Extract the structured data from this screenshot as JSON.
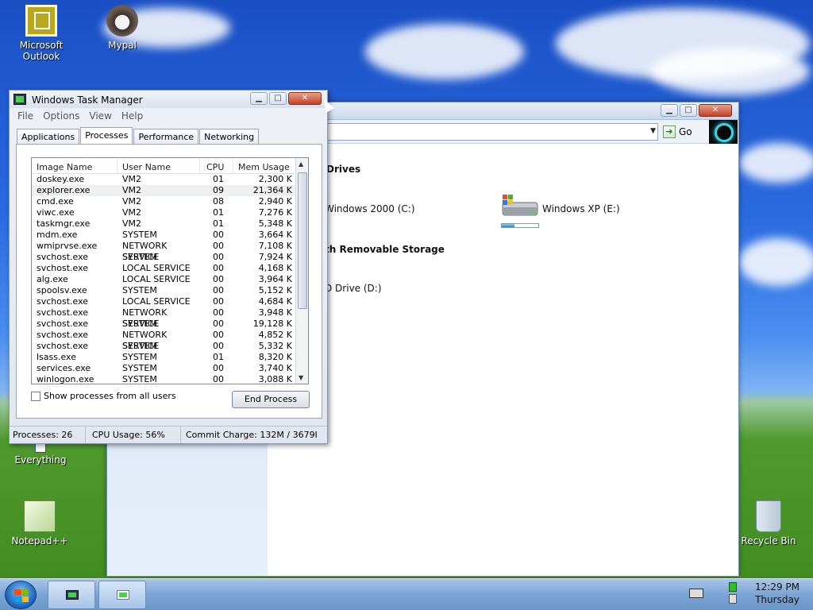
{
  "desktop": {
    "icons": [
      {
        "label": "Microsoft Outlook"
      },
      {
        "label": "Mypal"
      },
      {
        "label": "Everything"
      },
      {
        "label": "Notepad++"
      },
      {
        "label": "Recycle Bin"
      }
    ]
  },
  "explorer": {
    "go_label": "Go",
    "section_drives": "Drives",
    "section_removable": "th Removable Storage",
    "drive_c": "Windows 2000 (C:)",
    "drive_e": "Windows XP (E:)",
    "drive_d": "D Drive (D:)",
    "drive_e_usage_fraction": 0.35
  },
  "task_manager": {
    "title": "Windows Task Manager",
    "menu": [
      "File",
      "Options",
      "View",
      "Help"
    ],
    "tabs": [
      "Applications",
      "Processes",
      "Performance",
      "Networking"
    ],
    "active_tab": "Processes",
    "columns": [
      "Image Name",
      "User Name",
      "CPU",
      "Mem Usage"
    ],
    "processes": [
      [
        "doskey.exe",
        "VM2",
        "01",
        "2,300 K"
      ],
      [
        "explorer.exe",
        "VM2",
        "09",
        "21,364 K"
      ],
      [
        "cmd.exe",
        "VM2",
        "08",
        "2,940 K"
      ],
      [
        "viwc.exe",
        "VM2",
        "01",
        "7,276 K"
      ],
      [
        "taskmgr.exe",
        "VM2",
        "01",
        "5,348 K"
      ],
      [
        "mdm.exe",
        "SYSTEM",
        "00",
        "3,664 K"
      ],
      [
        "wmiprvse.exe",
        "NETWORK SERVICE",
        "00",
        "7,108 K"
      ],
      [
        "svchost.exe",
        "SYSTEM",
        "00",
        "7,924 K"
      ],
      [
        "svchost.exe",
        "LOCAL SERVICE",
        "00",
        "4,168 K"
      ],
      [
        "alg.exe",
        "LOCAL SERVICE",
        "00",
        "3,964 K"
      ],
      [
        "spoolsv.exe",
        "SYSTEM",
        "00",
        "5,152 K"
      ],
      [
        "svchost.exe",
        "LOCAL SERVICE",
        "00",
        "4,684 K"
      ],
      [
        "svchost.exe",
        "NETWORK SERVICE",
        "00",
        "3,948 K"
      ],
      [
        "svchost.exe",
        "SYSTEM",
        "00",
        "19,128 K"
      ],
      [
        "svchost.exe",
        "NETWORK SERVICE",
        "00",
        "4,852 K"
      ],
      [
        "svchost.exe",
        "SYSTEM",
        "00",
        "5,332 K"
      ],
      [
        "lsass.exe",
        "SYSTEM",
        "01",
        "8,320 K"
      ],
      [
        "services.exe",
        "SYSTEM",
        "00",
        "3,740 K"
      ],
      [
        "winlogon.exe",
        "SYSTEM",
        "00",
        "3,088 K"
      ]
    ],
    "show_all_label": "Show processes from all users",
    "end_process_label": "End Process",
    "status": {
      "processes": "Processes: 26",
      "cpu": "CPU Usage: 56%",
      "commit": "Commit Charge: 132M / 3679I"
    }
  },
  "taskbar": {
    "time": "12:29 PM",
    "day": "Thursday"
  }
}
